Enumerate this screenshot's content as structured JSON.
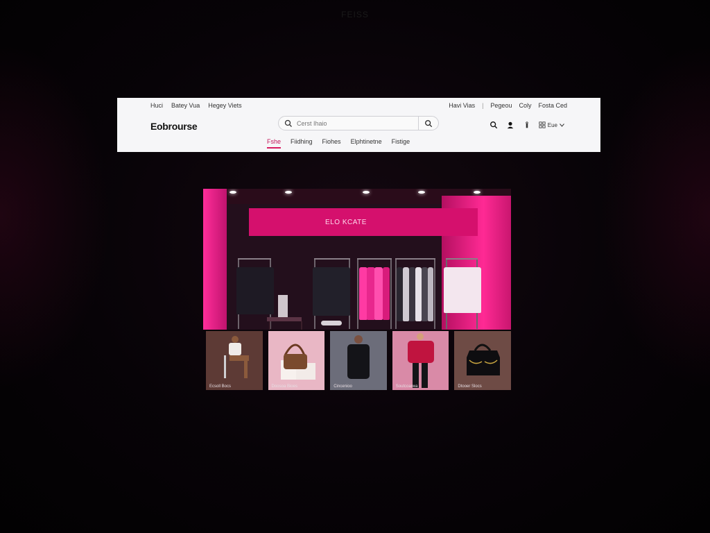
{
  "top_caption": "FEISS",
  "header": {
    "top_links_left": [
      "Huci",
      "Batey Vua",
      "Hegey Viets"
    ],
    "top_links_right": [
      "Havi Vias",
      "Pegeou",
      "Coly",
      "Fosta Ced"
    ],
    "logo": "Eobrourse",
    "search": {
      "placeholder": "Cerst Ihaio"
    },
    "lang_label": "Eue",
    "categories": [
      {
        "label": "Fshe",
        "active": true
      },
      {
        "label": "Fiidhing",
        "active": false
      },
      {
        "label": "Fiohes",
        "active": false
      },
      {
        "label": "Elphtinetne",
        "active": false
      },
      {
        "label": "Fistige",
        "active": false
      }
    ],
    "icons": [
      "search-icon",
      "user-icon",
      "bag-icon",
      "globe-icon",
      "chevron-down-icon"
    ]
  },
  "hero": {
    "store_sign": "ELO KCATE",
    "colors": {
      "accent": "#d5106d",
      "wall": "#ff2e9a",
      "dark": "#230f1c"
    }
  },
  "thumbnails": [
    {
      "caption": "Ecsoll Bocs",
      "bg": "#5a3a36"
    },
    {
      "caption": "Doosoa Bioes",
      "bg": "#e9b7c5"
    },
    {
      "caption": "Cincenioo",
      "bg": "#6d6e7a"
    },
    {
      "caption": "Soutcoarwa",
      "bg": "#d88aa7"
    },
    {
      "caption": "Dtooer Slocs",
      "bg": "#6e4b45"
    }
  ]
}
